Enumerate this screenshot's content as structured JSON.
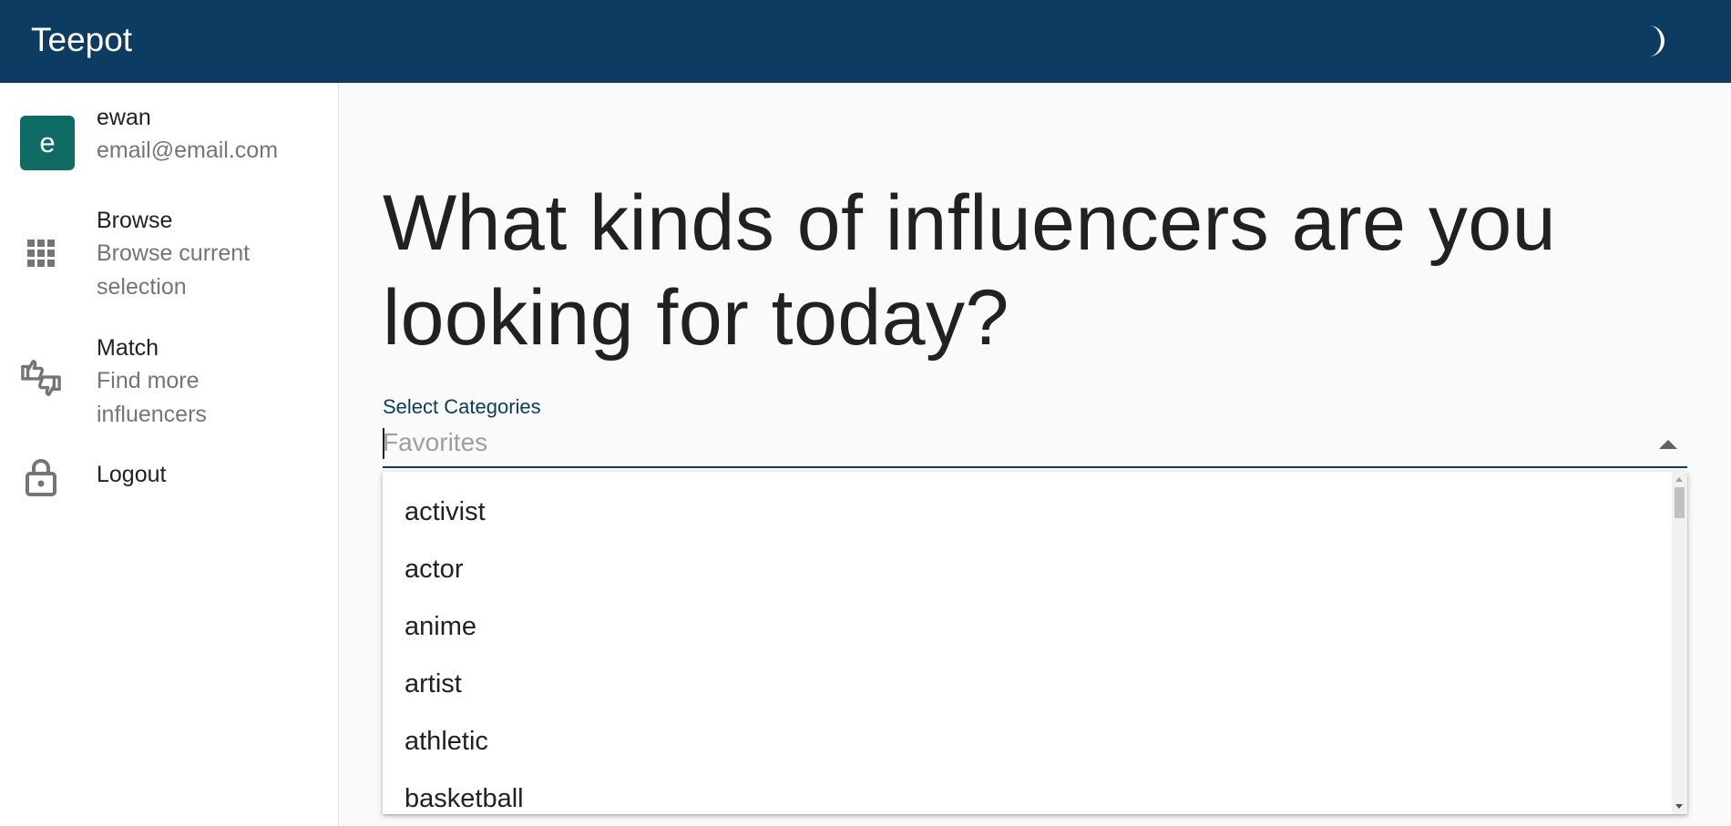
{
  "appbar": {
    "title": "Teepot",
    "theme_icon": "moon-icon",
    "color": "#0c3c61"
  },
  "user": {
    "avatar_letter": "e",
    "avatar_color": "#0e6b63",
    "name": "ewan",
    "email": "email@email.com"
  },
  "sidebar": {
    "items": [
      {
        "label": "Browse",
        "secondary_line1": "Browse current",
        "secondary_line2": "selection",
        "icon": "grid-icon"
      },
      {
        "label": "Match",
        "secondary_line1": "Find more",
        "secondary_line2": "influencers",
        "icon": "thumbs-icon"
      },
      {
        "label": "Logout",
        "icon": "lock-icon"
      }
    ]
  },
  "main": {
    "headline_line1": "What kinds of influencers are you",
    "headline_line2": "looking for today?",
    "select": {
      "label": "Select Categories",
      "placeholder": "Favorites",
      "value": "",
      "expanded": true,
      "options": [
        "activist",
        "actor",
        "anime",
        "artist",
        "athletic",
        "basketball"
      ]
    }
  }
}
